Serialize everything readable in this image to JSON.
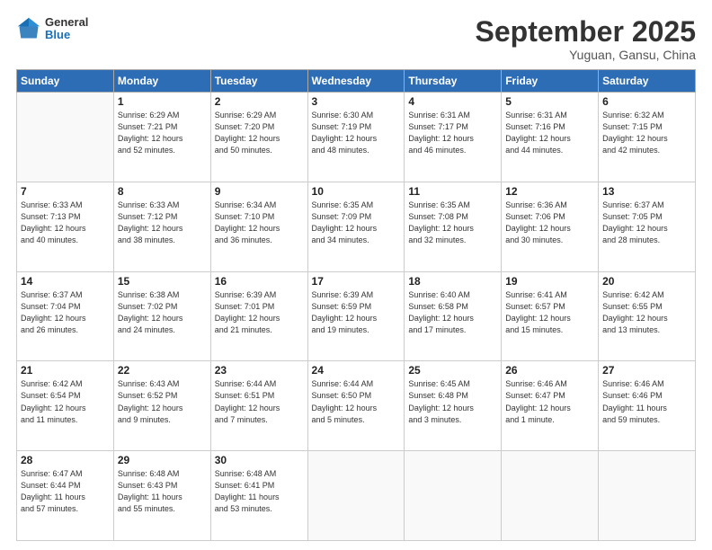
{
  "header": {
    "logo": {
      "general": "General",
      "blue": "Blue"
    },
    "title": "September 2025",
    "location": "Yuguan, Gansu, China"
  },
  "days_header": [
    "Sunday",
    "Monday",
    "Tuesday",
    "Wednesday",
    "Thursday",
    "Friday",
    "Saturday"
  ],
  "weeks": [
    [
      {
        "day": "",
        "info": ""
      },
      {
        "day": "1",
        "info": "Sunrise: 6:29 AM\nSunset: 7:21 PM\nDaylight: 12 hours\nand 52 minutes."
      },
      {
        "day": "2",
        "info": "Sunrise: 6:29 AM\nSunset: 7:20 PM\nDaylight: 12 hours\nand 50 minutes."
      },
      {
        "day": "3",
        "info": "Sunrise: 6:30 AM\nSunset: 7:19 PM\nDaylight: 12 hours\nand 48 minutes."
      },
      {
        "day": "4",
        "info": "Sunrise: 6:31 AM\nSunset: 7:17 PM\nDaylight: 12 hours\nand 46 minutes."
      },
      {
        "day": "5",
        "info": "Sunrise: 6:31 AM\nSunset: 7:16 PM\nDaylight: 12 hours\nand 44 minutes."
      },
      {
        "day": "6",
        "info": "Sunrise: 6:32 AM\nSunset: 7:15 PM\nDaylight: 12 hours\nand 42 minutes."
      }
    ],
    [
      {
        "day": "7",
        "info": "Sunrise: 6:33 AM\nSunset: 7:13 PM\nDaylight: 12 hours\nand 40 minutes."
      },
      {
        "day": "8",
        "info": "Sunrise: 6:33 AM\nSunset: 7:12 PM\nDaylight: 12 hours\nand 38 minutes."
      },
      {
        "day": "9",
        "info": "Sunrise: 6:34 AM\nSunset: 7:10 PM\nDaylight: 12 hours\nand 36 minutes."
      },
      {
        "day": "10",
        "info": "Sunrise: 6:35 AM\nSunset: 7:09 PM\nDaylight: 12 hours\nand 34 minutes."
      },
      {
        "day": "11",
        "info": "Sunrise: 6:35 AM\nSunset: 7:08 PM\nDaylight: 12 hours\nand 32 minutes."
      },
      {
        "day": "12",
        "info": "Sunrise: 6:36 AM\nSunset: 7:06 PM\nDaylight: 12 hours\nand 30 minutes."
      },
      {
        "day": "13",
        "info": "Sunrise: 6:37 AM\nSunset: 7:05 PM\nDaylight: 12 hours\nand 28 minutes."
      }
    ],
    [
      {
        "day": "14",
        "info": "Sunrise: 6:37 AM\nSunset: 7:04 PM\nDaylight: 12 hours\nand 26 minutes."
      },
      {
        "day": "15",
        "info": "Sunrise: 6:38 AM\nSunset: 7:02 PM\nDaylight: 12 hours\nand 24 minutes."
      },
      {
        "day": "16",
        "info": "Sunrise: 6:39 AM\nSunset: 7:01 PM\nDaylight: 12 hours\nand 21 minutes."
      },
      {
        "day": "17",
        "info": "Sunrise: 6:39 AM\nSunset: 6:59 PM\nDaylight: 12 hours\nand 19 minutes."
      },
      {
        "day": "18",
        "info": "Sunrise: 6:40 AM\nSunset: 6:58 PM\nDaylight: 12 hours\nand 17 minutes."
      },
      {
        "day": "19",
        "info": "Sunrise: 6:41 AM\nSunset: 6:57 PM\nDaylight: 12 hours\nand 15 minutes."
      },
      {
        "day": "20",
        "info": "Sunrise: 6:42 AM\nSunset: 6:55 PM\nDaylight: 12 hours\nand 13 minutes."
      }
    ],
    [
      {
        "day": "21",
        "info": "Sunrise: 6:42 AM\nSunset: 6:54 PM\nDaylight: 12 hours\nand 11 minutes."
      },
      {
        "day": "22",
        "info": "Sunrise: 6:43 AM\nSunset: 6:52 PM\nDaylight: 12 hours\nand 9 minutes."
      },
      {
        "day": "23",
        "info": "Sunrise: 6:44 AM\nSunset: 6:51 PM\nDaylight: 12 hours\nand 7 minutes."
      },
      {
        "day": "24",
        "info": "Sunrise: 6:44 AM\nSunset: 6:50 PM\nDaylight: 12 hours\nand 5 minutes."
      },
      {
        "day": "25",
        "info": "Sunrise: 6:45 AM\nSunset: 6:48 PM\nDaylight: 12 hours\nand 3 minutes."
      },
      {
        "day": "26",
        "info": "Sunrise: 6:46 AM\nSunset: 6:47 PM\nDaylight: 12 hours\nand 1 minute."
      },
      {
        "day": "27",
        "info": "Sunrise: 6:46 AM\nSunset: 6:46 PM\nDaylight: 11 hours\nand 59 minutes."
      }
    ],
    [
      {
        "day": "28",
        "info": "Sunrise: 6:47 AM\nSunset: 6:44 PM\nDaylight: 11 hours\nand 57 minutes."
      },
      {
        "day": "29",
        "info": "Sunrise: 6:48 AM\nSunset: 6:43 PM\nDaylight: 11 hours\nand 55 minutes."
      },
      {
        "day": "30",
        "info": "Sunrise: 6:48 AM\nSunset: 6:41 PM\nDaylight: 11 hours\nand 53 minutes."
      },
      {
        "day": "",
        "info": ""
      },
      {
        "day": "",
        "info": ""
      },
      {
        "day": "",
        "info": ""
      },
      {
        "day": "",
        "info": ""
      }
    ]
  ]
}
